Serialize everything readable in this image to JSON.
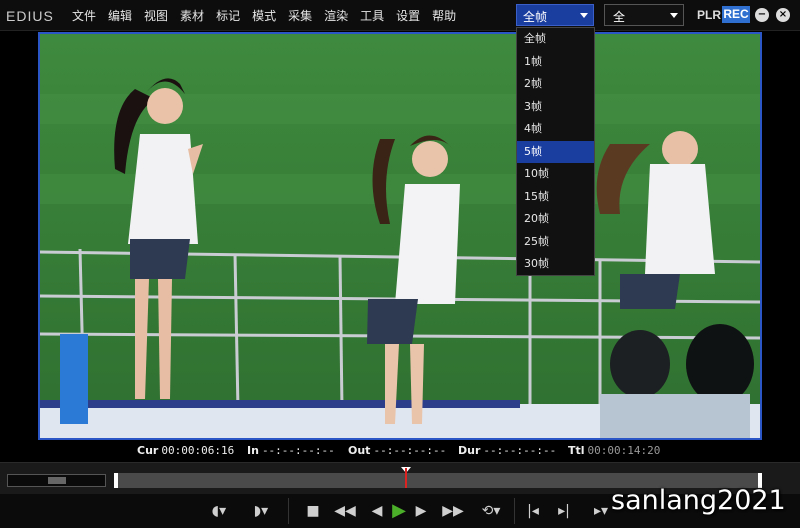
{
  "app": {
    "logo": "EDIUS"
  },
  "menu": [
    "文件",
    "编辑",
    "视图",
    "素材",
    "标记",
    "模式",
    "采集",
    "渲染",
    "工具",
    "设置",
    "帮助"
  ],
  "frame_dropdown": {
    "selected": "全帧",
    "options": [
      "全帧",
      "1帧",
      "2帧",
      "3帧",
      "4帧",
      "5帧",
      "10帧",
      "15帧",
      "20帧",
      "25帧",
      "30帧"
    ],
    "highlighted": "5帧"
  },
  "view_dropdown": {
    "selected": "全"
  },
  "mode": {
    "plr": "PLR",
    "rec": "REC"
  },
  "timecodes": {
    "cur": {
      "label": "Cur",
      "value": "00:00:06:16"
    },
    "in": {
      "label": "In",
      "value": "--:--:--:--"
    },
    "out": {
      "label": "Out",
      "value": "--:--:--:--"
    },
    "dur": {
      "label": "Dur",
      "value": "--:--:--:--"
    },
    "ttl": {
      "label": "Ttl",
      "value": "00:00:14:20"
    }
  },
  "playback": {
    "position": 0.45
  },
  "colors": {
    "accent": "#1a3da0",
    "rec": "#2f6fd0",
    "play": "#4caf2a",
    "playhead": "#d22222"
  },
  "watermark": "sanlang2021"
}
